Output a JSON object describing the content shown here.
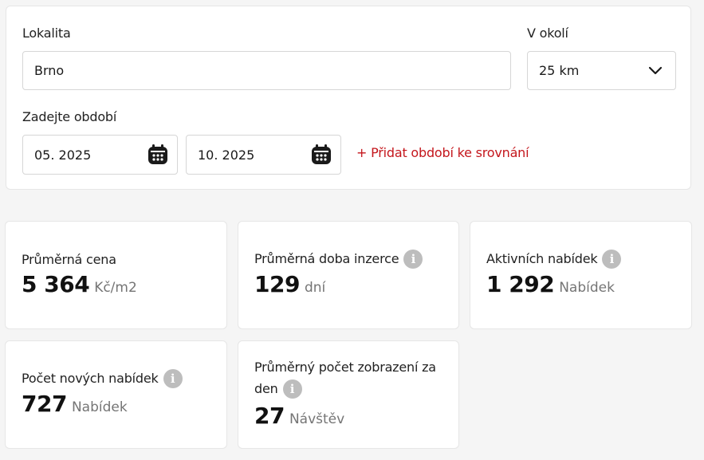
{
  "filters": {
    "location_label": "Lokalita",
    "location_value": "Brno",
    "radius_label": "V okolí",
    "radius_value": "25 km",
    "period_label": "Zadejte období",
    "period_from": "05. 2025",
    "period_to": "10. 2025",
    "add_period_link": "+ Přidat období ke srovnání"
  },
  "stats": [
    {
      "title": "Průměrná cena",
      "value": "5 364",
      "unit": "Kč/m2"
    },
    {
      "title": "Průměrná doba inzerce",
      "value": "129",
      "unit": "dní"
    },
    {
      "title": "Aktivních nabídek",
      "value": "1 292",
      "unit": "Nabídek"
    },
    {
      "title": "Počet nových nabídek",
      "value": "727",
      "unit": "Nabídek"
    },
    {
      "title_line1": "Průměrný počet zobrazení za",
      "title_line2": "den",
      "value": "27",
      "unit": "Návštěv"
    }
  ],
  "icons": {
    "info": "info-icon",
    "calendar": "calendar-icon",
    "chevron": "chevron-down-icon"
  },
  "colors": {
    "accent_link": "#c4161c",
    "background": "#f5f5f5",
    "card": "#ffffff",
    "info_icon": "#bdbdbd"
  }
}
